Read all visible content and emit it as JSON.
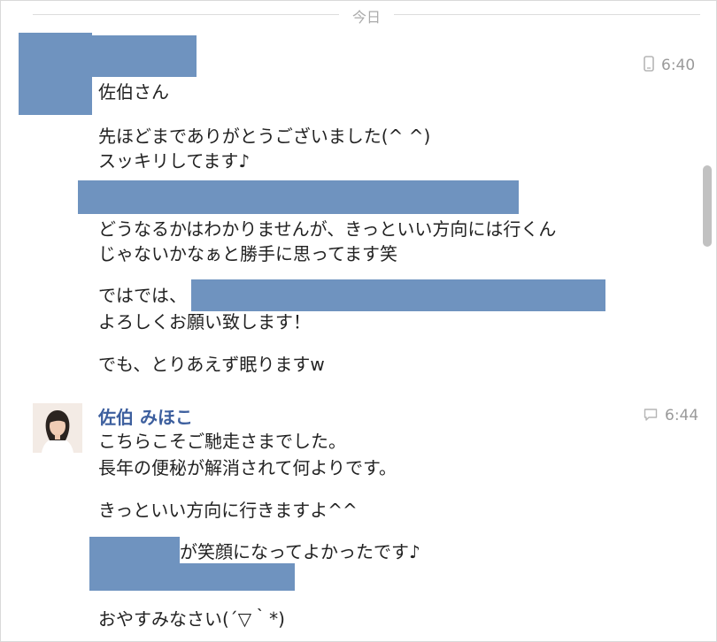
{
  "date_divider": {
    "label": "今日"
  },
  "thread": {
    "messages": [
      {
        "time": "6:40",
        "lines": [
          "佐伯さん",
          "先ほどまでありがとうございました(^ ^)",
          "スッキリしてます♪",
          "どうなるかはわかりませんが、きっといい方向には行くん",
          "じゃないかなぁと勝手に思ってます笑",
          "ではでは、",
          "よろしくお願い致します！",
          "でも、とりあえず眠りますw"
        ]
      },
      {
        "sender": "佐伯 みほこ",
        "time": "6:44",
        "lines": [
          "こちらこそご馳走さまでした。",
          "長年の便秘が解消されて何よりです。",
          "きっといい方向に行きますよ^^",
          "が笑顔になってよかったです♪",
          "おやすみなさい(´▽｀*)"
        ]
      }
    ]
  },
  "colors": {
    "redaction": "#6f93bf",
    "sender_name": "#3d5f9e",
    "timestamp": "#9a9a9a",
    "divider_line": "#dcdcdc"
  },
  "icons": {
    "first_time_icon": "phone-icon",
    "second_time_icon": "chat-bubble-icon"
  }
}
